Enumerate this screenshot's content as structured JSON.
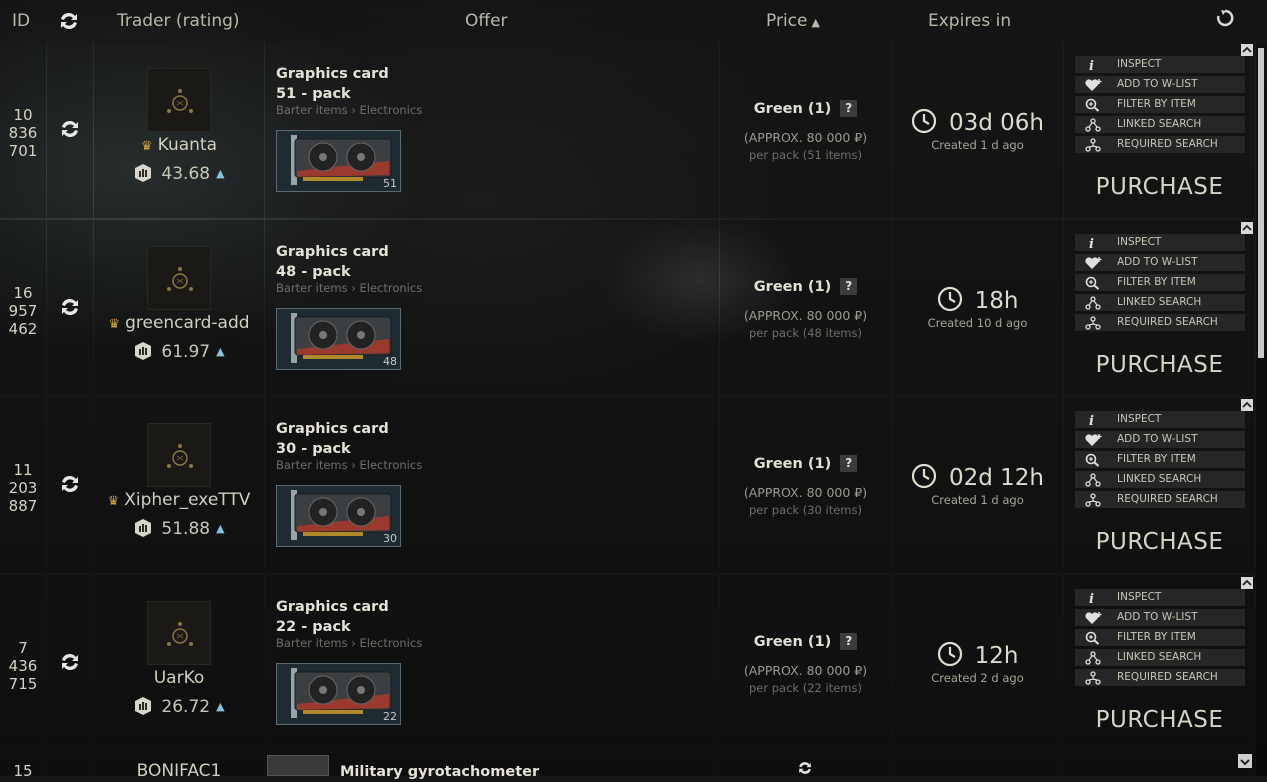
{
  "header": {
    "id": "ID",
    "trader": "Trader (rating)",
    "offer": "Offer",
    "price": "Price",
    "expires": "Expires in"
  },
  "offers": [
    {
      "id_lines": [
        "10",
        "836",
        "701"
      ],
      "trader": "Kuanta",
      "crown": true,
      "rating": "43.68",
      "item_name": "Graphics card",
      "pack": "51 - pack",
      "category": "Barter items › Electronics",
      "count": "51",
      "price": "Green (1)",
      "approx": "(APPROX. 80 000 ₽)",
      "per_pack": "per pack (51 items)",
      "expires": "03d 06h",
      "created": "Created 1 d ago"
    },
    {
      "id_lines": [
        "16",
        "957",
        "462"
      ],
      "trader": "greencard-add",
      "crown": true,
      "rating": "61.97",
      "item_name": "Graphics card",
      "pack": "48 - pack",
      "category": "Barter items › Electronics",
      "count": "48",
      "price": "Green (1)",
      "approx": "(APPROX. 80 000 ₽)",
      "per_pack": "per pack (48 items)",
      "expires": "18h",
      "created": "Created 10 d ago"
    },
    {
      "id_lines": [
        "11",
        "203",
        "887"
      ],
      "trader": "Xipher_exeTTV",
      "crown": true,
      "rating": "51.88",
      "item_name": "Graphics card",
      "pack": "30 - pack",
      "category": "Barter items › Electronics",
      "count": "30",
      "price": "Green (1)",
      "approx": "(APPROX. 80 000 ₽)",
      "per_pack": "per pack (30 items)",
      "expires": "02d 12h",
      "created": "Created 1 d ago"
    },
    {
      "id_lines": [
        "7",
        "436",
        "715"
      ],
      "trader": "UarKo",
      "crown": false,
      "rating": "26.72",
      "item_name": "Graphics card",
      "pack": "22 - pack",
      "category": "Barter items › Electronics",
      "count": "22",
      "price": "Green (1)",
      "approx": "(APPROX. 80 000 ₽)",
      "per_pack": "per pack (22 items)",
      "expires": "12h",
      "created": "Created 2 d ago"
    }
  ],
  "actions": {
    "inspect": "INSPECT",
    "wishlist": "ADD TO W-LIST",
    "filter": "FILTER BY ITEM",
    "linked": "LINKED SEARCH",
    "required": "REQUIRED SEARCH",
    "purchase": "PURCHASE"
  },
  "price_help": "?",
  "partial_row": {
    "id": "15",
    "trader": "BONIFAC1",
    "item_name": "Military gyrotachometer"
  }
}
